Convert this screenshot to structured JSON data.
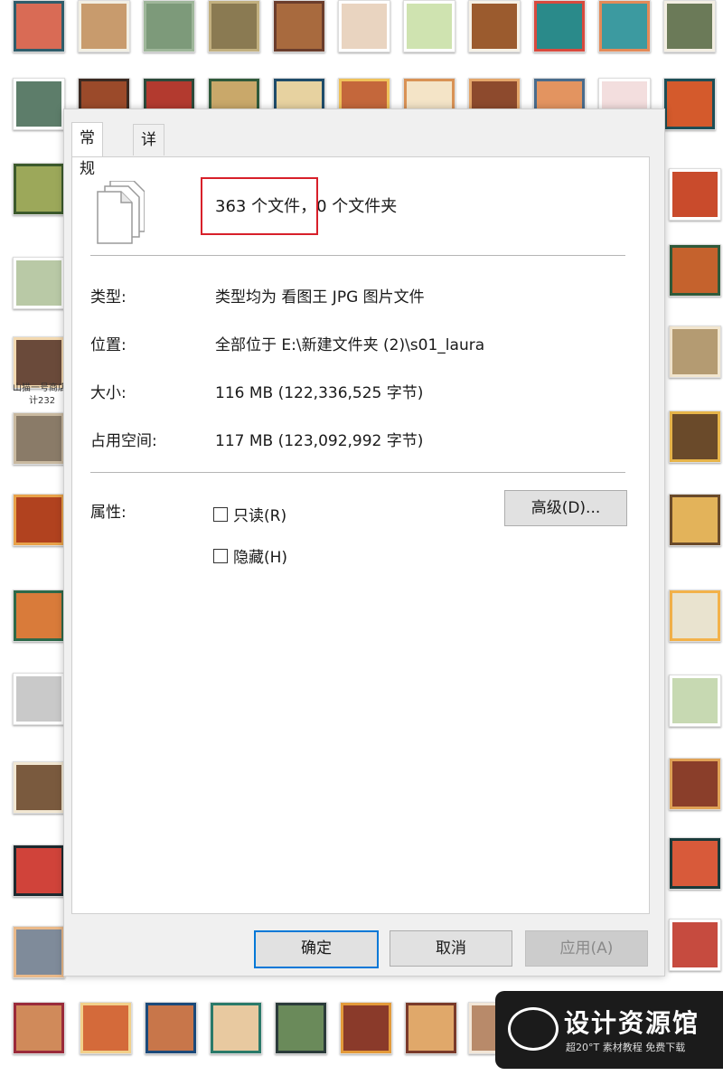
{
  "dialog": {
    "tabs": [
      {
        "label": "常规"
      },
      {
        "label": "详细信息"
      }
    ],
    "summary": {
      "files": "363 个文件，",
      "folders": "0 个文件夹"
    },
    "rows": [
      {
        "label": "类型:",
        "value": "类型均为 看图王 JPG 图片文件"
      },
      {
        "label": "位置:",
        "value": "全部位于 E:\\新建文件夹 (2)\\s01_laura"
      },
      {
        "label": "大小:",
        "value": "116 MB (122,336,525 字节)"
      },
      {
        "label": "占用空间:",
        "value": "117 MB (123,092,992 字节)"
      }
    ],
    "attributes": {
      "label": "属性:",
      "readonly": "只读(R)",
      "hidden": "隐藏(H)",
      "advanced": "高级(D)..."
    },
    "buttons": {
      "ok": "确定",
      "cancel": "取消",
      "apply": "应用(A)"
    }
  },
  "background": {
    "captions": {
      "thumb_a": "山猫一号商店",
      "thumb_b": "计232"
    }
  },
  "watermark": {
    "title": "设计资源馆",
    "subtitle": "超20°T 素材教程 免费下载"
  }
}
